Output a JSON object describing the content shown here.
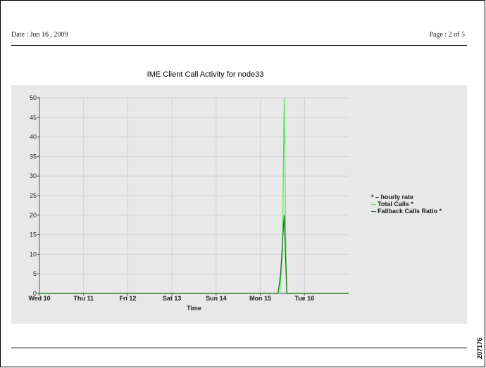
{
  "header": {
    "date_text": "Date : Jun 16 , 2009",
    "page_text": "Page : 2 of 5"
  },
  "figure_id": "207176",
  "legend": {
    "note": "* – hourly rate",
    "items": [
      {
        "label": "Total Calls *",
        "color": "#44ee44"
      },
      {
        "label": "Fallback Calls Ratio *",
        "color": "#1a6a1a"
      }
    ]
  },
  "chart_data": {
    "type": "line",
    "title": "IME Client Call Activity for node33",
    "xlabel": "Time",
    "ylabel": "",
    "x_unit": "day",
    "xlim": [
      0,
      7
    ],
    "ylim": [
      0,
      50
    ],
    "yticks": [
      0,
      5,
      10,
      15,
      20,
      25,
      30,
      35,
      40,
      45,
      50
    ],
    "xticks": [
      {
        "label": "Wed 10",
        "x": 0
      },
      {
        "label": "Thu 11",
        "x": 1
      },
      {
        "label": "Fri 12",
        "x": 2
      },
      {
        "label": "Sat 13",
        "x": 3
      },
      {
        "label": "Sun 14",
        "x": 4
      },
      {
        "label": "Mon 15",
        "x": 5
      },
      {
        "label": "Tue 16",
        "x": 6
      }
    ],
    "grid": true,
    "series": [
      {
        "name": "Total Calls *",
        "color": "#44ee44",
        "points": [
          [
            0,
            0
          ],
          [
            5.44,
            0
          ],
          [
            5.5,
            10
          ],
          [
            5.54,
            50
          ],
          [
            5.58,
            10
          ],
          [
            5.6,
            0
          ],
          [
            7,
            0
          ]
        ]
      },
      {
        "name": "Fallback Calls Ratio *",
        "color": "#1a6a1a",
        "points": [
          [
            0,
            0
          ],
          [
            5.4,
            0
          ],
          [
            5.46,
            5
          ],
          [
            5.54,
            20
          ],
          [
            5.6,
            0
          ],
          [
            7,
            0
          ]
        ]
      }
    ]
  }
}
